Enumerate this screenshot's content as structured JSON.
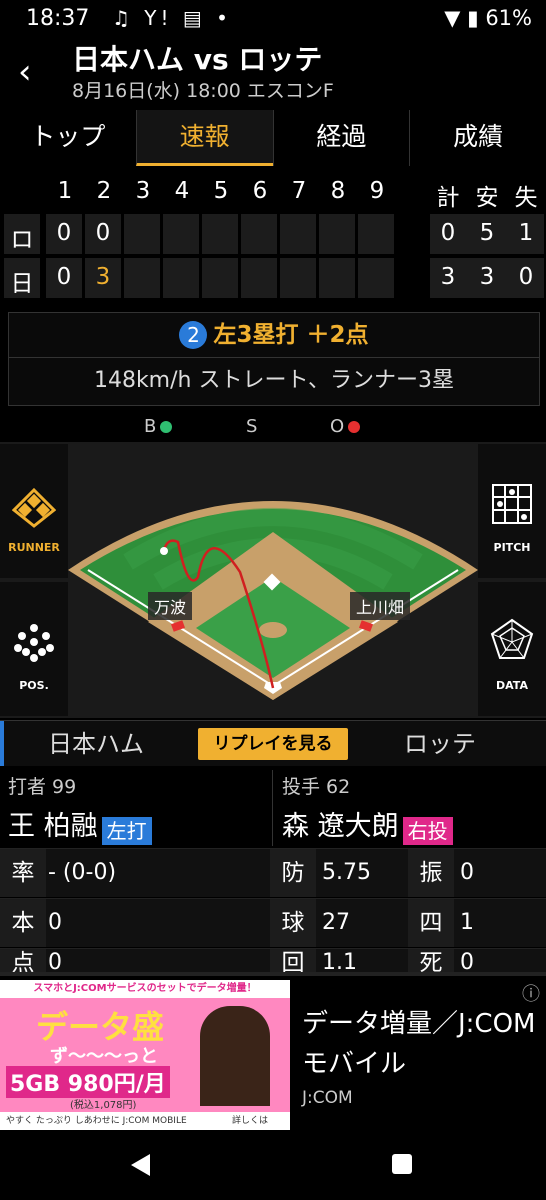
{
  "status_bar": {
    "time": "18:37",
    "icons": "♫ Y! ▤ •",
    "battery": "61%"
  },
  "header": {
    "title": "日本ハム vs ロッテ",
    "subtitle": "8月16日(水) 18:00 エスコンF"
  },
  "tabs": [
    {
      "label": "トップ"
    },
    {
      "label": "速報"
    },
    {
      "label": "経過"
    },
    {
      "label": "成績"
    }
  ],
  "scoreboard": {
    "innings": [
      "1",
      "2",
      "3",
      "4",
      "5",
      "6",
      "7",
      "8",
      "9"
    ],
    "totals_headers": [
      "計",
      "安",
      "失"
    ],
    "rows": [
      {
        "team": "ロ",
        "scores": [
          "0",
          "0",
          "",
          "",
          "",
          "",
          "",
          "",
          ""
        ],
        "totals": [
          "0",
          "5",
          "1"
        ]
      },
      {
        "team": "日",
        "scores": [
          "0",
          "3",
          "",
          "",
          "",
          "",
          "",
          "",
          ""
        ],
        "totals": [
          "3",
          "3",
          "0"
        ]
      }
    ]
  },
  "play": {
    "number": "2",
    "result": "左3塁打 ＋2点",
    "detail": "148km/h ストレート、ランナー3塁"
  },
  "count": {
    "b": "B",
    "s": "S",
    "o": "O",
    "ball_color": "#2fbf71",
    "out_color": "#e53030"
  },
  "field": {
    "runner_label": "RUNNER",
    "pitch_label": "PITCH",
    "pos_label": "POS.",
    "data_label": "DATA",
    "fielder_third": "万波",
    "fielder_first": "上川畑"
  },
  "teams_bar": {
    "home": "日本ハム",
    "replay": "リプレイを見る",
    "away": "ロッテ"
  },
  "batter": {
    "role": "打者 99",
    "name": "王 柏融",
    "tag": "左打",
    "tag_color": "#2a7bd9"
  },
  "pitcher": {
    "role": "投手 62",
    "name": "森 遼大朗",
    "tag": "右投",
    "tag_color": "#e0288a"
  },
  "batter_stats": [
    {
      "key": "率",
      "value": "- (0-0)"
    },
    {
      "key": "本",
      "value": "0"
    },
    {
      "key": "点",
      "value": "0"
    }
  ],
  "pitcher_stats": [
    {
      "k1": "防",
      "v1": "5.75",
      "k2": "振",
      "v2": "0"
    },
    {
      "k1": "球",
      "v1": "27",
      "k2": "四",
      "v2": "1"
    },
    {
      "k1": "回",
      "v1": "1.1",
      "k2": "死",
      "v2": "0"
    }
  ],
  "ad": {
    "banner_top": "スマホとJ:COMサービスのセットでデータ増量！",
    "brand": "データ盛",
    "slogan": "ず〜〜〜っと",
    "price": "5GB 980円/月",
    "tax_note": "(税込1,078円)",
    "footer": "やすく たっぷり しあわせに J:COM MOBILE",
    "more": "詳しくは",
    "headline": "データ増量／J:COMモバイル",
    "source": "J:COM",
    "info_icon": "ⓘ"
  }
}
